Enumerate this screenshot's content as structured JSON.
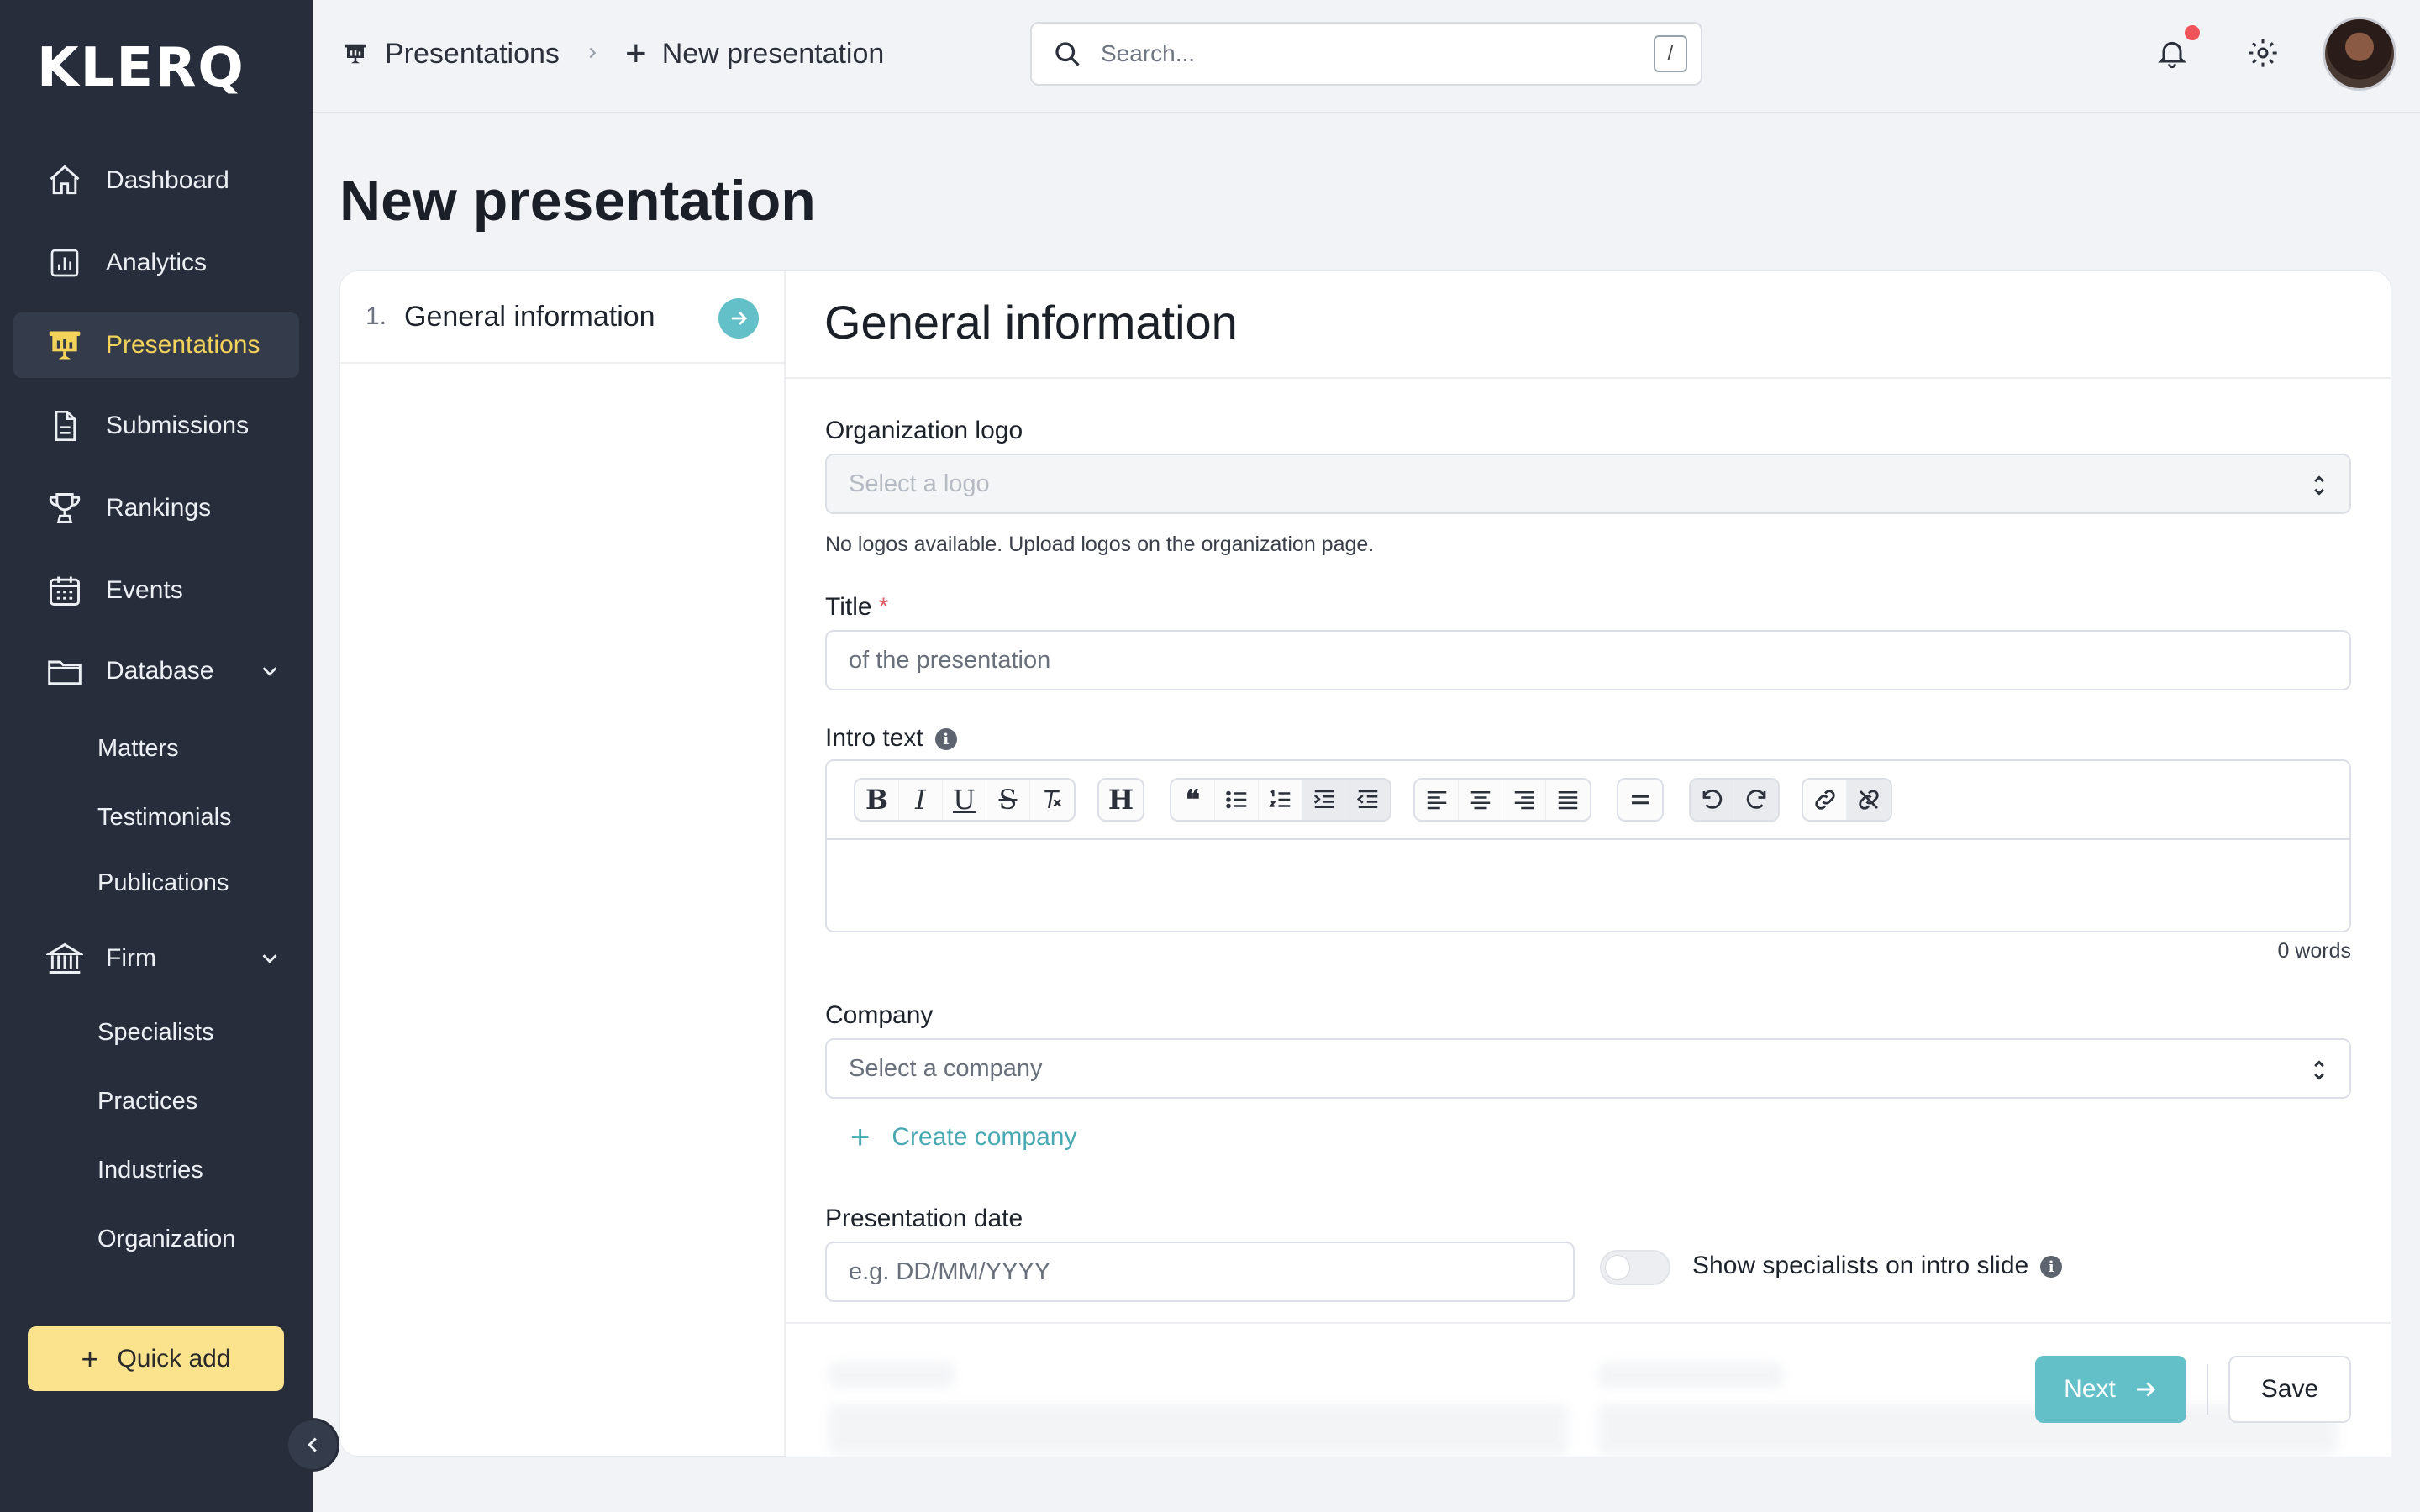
{
  "brand": {
    "logo": "KLERQ"
  },
  "sidebar": {
    "items": [
      {
        "label": "Dashboard",
        "icon": "home-icon"
      },
      {
        "label": "Analytics",
        "icon": "bar-chart-icon"
      },
      {
        "label": "Presentations",
        "icon": "presentation-icon",
        "active": true
      },
      {
        "label": "Submissions",
        "icon": "document-icon"
      },
      {
        "label": "Rankings",
        "icon": "trophy-icon"
      },
      {
        "label": "Events",
        "icon": "calendar-icon"
      },
      {
        "label": "Database",
        "icon": "folder-icon",
        "expanded": true
      },
      {
        "label": "Firm",
        "icon": "bank-icon",
        "expanded": true
      }
    ],
    "database_sub": [
      "Matters",
      "Testimonials",
      "Publications"
    ],
    "firm_sub": [
      "Specialists",
      "Practices",
      "Industries",
      "Organization"
    ],
    "quick_add": "Quick add"
  },
  "header": {
    "breadcrumb": [
      "Presentations",
      "New presentation"
    ],
    "search_placeholder": "Search...",
    "search_shortcut": "/"
  },
  "page": {
    "title": "New presentation"
  },
  "steps": [
    {
      "number": "1.",
      "label": "General information"
    }
  ],
  "form": {
    "heading": "General information",
    "logo": {
      "label": "Organization logo",
      "placeholder": "Select a logo",
      "help": "No logos available. Upload logos on the organization page."
    },
    "title": {
      "label": "Title",
      "required_mark": "*",
      "placeholder": "of the presentation"
    },
    "intro": {
      "label": "Intro text",
      "word_count": "0 words"
    },
    "company": {
      "label": "Company",
      "placeholder": "Select a company",
      "create_link": "Create company"
    },
    "date": {
      "label": "Presentation date",
      "placeholder": "e.g. DD/MM/YYYY"
    },
    "toggle": {
      "label": "Show specialists on intro slide",
      "on": false
    }
  },
  "footer": {
    "next": "Next",
    "save": "Save"
  },
  "colors": {
    "sidebar_bg": "#272d3b",
    "accent": "#63bfc8",
    "active_nav": "#f3d35a",
    "quick_add_bg": "#fbe38d"
  }
}
